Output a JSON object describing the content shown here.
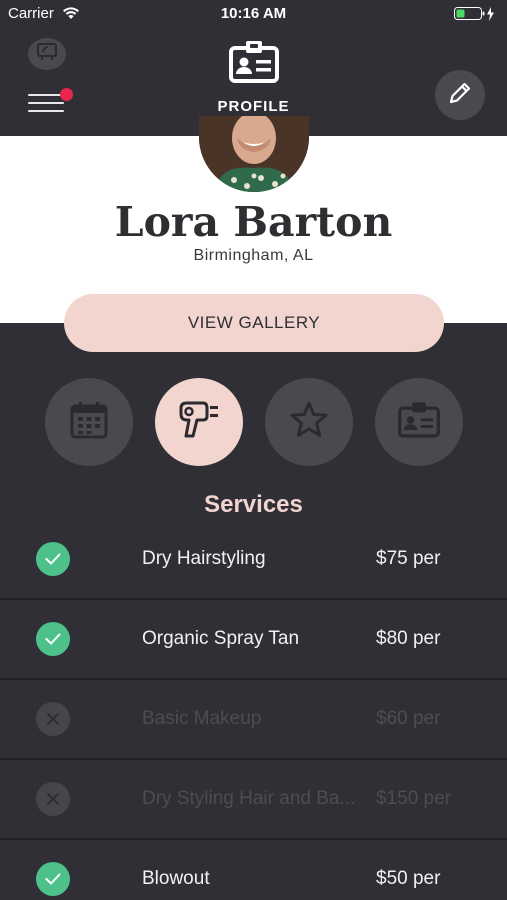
{
  "status_bar": {
    "carrier": "Carrier",
    "time": "10:16 AM"
  },
  "header": {
    "title": "PROFILE",
    "icons": {
      "cast": "cast-icon",
      "menu": "hamburger-menu-icon",
      "profile": "id-card-icon",
      "edit": "pencil-icon"
    },
    "notification_dot_color": "#e9254e"
  },
  "profile": {
    "name": "Lora Barton",
    "location": "Birmingham, AL"
  },
  "gallery_button": {
    "label": "VIEW GALLERY"
  },
  "tabs": [
    {
      "icon": "calendar-icon",
      "active": false
    },
    {
      "icon": "hairdryer-icon",
      "active": true
    },
    {
      "icon": "star-icon",
      "active": false
    },
    {
      "icon": "id-card-icon",
      "active": false
    }
  ],
  "services": {
    "title": "Services",
    "items": [
      {
        "name": "Dry Hairstyling",
        "price": "$75 per",
        "enabled": true
      },
      {
        "name": "Organic Spray Tan",
        "price": "$80 per",
        "enabled": true
      },
      {
        "name": "Basic Makeup",
        "price": "$60 per",
        "enabled": false
      },
      {
        "name": "Dry Styling Hair and Ba...",
        "price": "$150 per",
        "enabled": false
      },
      {
        "name": "Blowout",
        "price": "$50 per",
        "enabled": true
      }
    ]
  },
  "colors": {
    "background": "#302f35",
    "accent_pink": "#f2d5cf",
    "check_green": "#4ec18b",
    "disabled_text": "#4d4c53"
  }
}
